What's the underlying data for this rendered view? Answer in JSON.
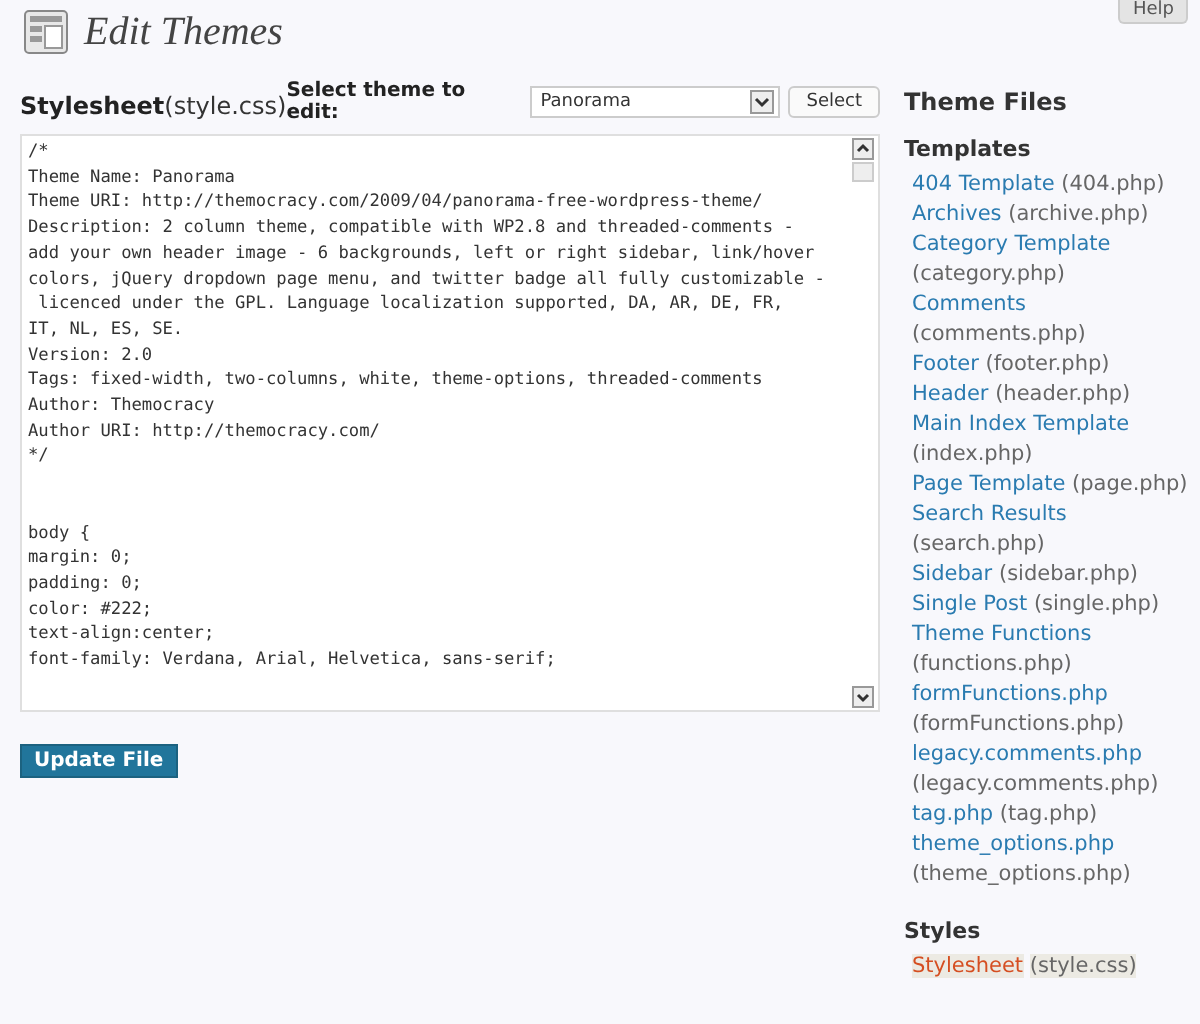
{
  "help_button": {
    "label": "Help"
  },
  "page_title": "Edit Themes",
  "file_heading": {
    "name": "Stylesheet",
    "file": "(style.css)"
  },
  "theme_select": {
    "label": "Select theme to edit:",
    "value": "Panorama",
    "button": "Select"
  },
  "editor": {
    "value": "/*\nTheme Name: Panorama\nTheme URI: http://themocracy.com/2009/04/panorama-free-wordpress-theme/\nDescription: 2 column theme, compatible with WP2.8 and threaded-comments -\nadd your own header image - 6 backgrounds, left or right sidebar, link/hover\ncolors, jQuery dropdown page menu, and twitter badge all fully customizable -\n licenced under the GPL. Language localization supported, DA, AR, DE, FR,\nIT, NL, ES, SE.\nVersion: 2.0\nTags: fixed-width, two-columns, white, theme-options, threaded-comments\nAuthor: Themocracy\nAuthor URI: http://themocracy.com/\n*/\n\n\nbody {\nmargin: 0;\npadding: 0;\ncolor: #222;\ntext-align:center;\nfont-family: Verdana, Arial, Helvetica, sans-serif;"
  },
  "update_button": "Update File",
  "sidebar": {
    "title": "Theme Files",
    "sections": [
      {
        "title": "Templates",
        "files": [
          {
            "name": "404 Template",
            "file": "(404.php)",
            "selected": false
          },
          {
            "name": "Archives",
            "file": "(archive.php)",
            "selected": false
          },
          {
            "name": "Category Template",
            "file": "(category.php)",
            "selected": false
          },
          {
            "name": "Comments",
            "file": "(comments.php)",
            "selected": false
          },
          {
            "name": "Footer",
            "file": "(footer.php)",
            "selected": false
          },
          {
            "name": "Header",
            "file": "(header.php)",
            "selected": false
          },
          {
            "name": "Main Index Template",
            "file": "(index.php)",
            "selected": false
          },
          {
            "name": "Page Template",
            "file": "(page.php)",
            "selected": false
          },
          {
            "name": "Search Results",
            "file": "(search.php)",
            "selected": false
          },
          {
            "name": "Sidebar",
            "file": "(sidebar.php)",
            "selected": false
          },
          {
            "name": "Single Post",
            "file": "(single.php)",
            "selected": false
          },
          {
            "name": "Theme Functions",
            "file": "(functions.php)",
            "selected": false
          },
          {
            "name": "formFunctions.php",
            "file": "(formFunctions.php)",
            "selected": false
          },
          {
            "name": "legacy.comments.php",
            "file": "(legacy.comments.php)",
            "selected": false
          },
          {
            "name": "tag.php",
            "file": "(tag.php)",
            "selected": false
          },
          {
            "name": "theme_options.php",
            "file": "(theme_options.php)",
            "selected": false
          }
        ]
      },
      {
        "title": "Styles",
        "files": [
          {
            "name": "Stylesheet",
            "file": "(style.css)",
            "selected": true
          }
        ]
      }
    ]
  }
}
